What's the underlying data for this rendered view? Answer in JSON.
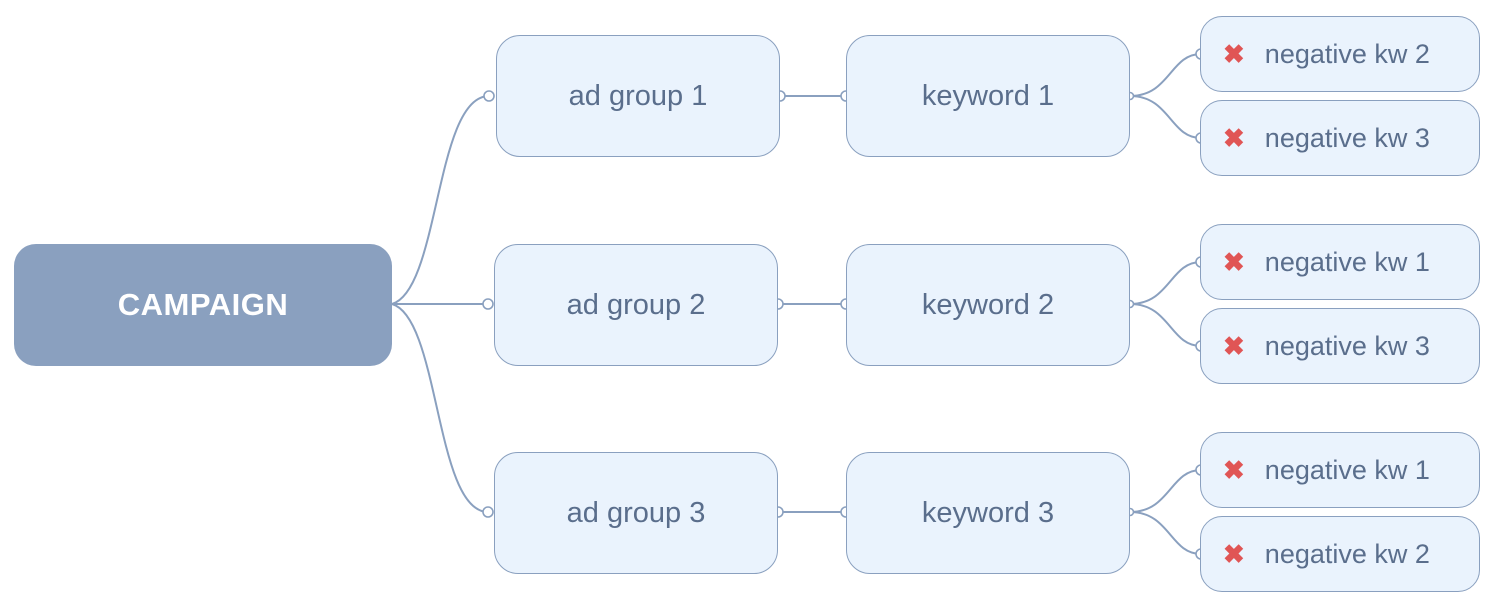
{
  "root": {
    "label": "CAMPAIGN"
  },
  "ad_groups": [
    {
      "label": "ad group 1",
      "keyword": "keyword 1",
      "negatives": [
        "negative kw 2",
        "negative kw 3"
      ]
    },
    {
      "label": "ad group 2",
      "keyword": "keyword 2",
      "negatives": [
        "negative kw 1",
        "negative kw 3"
      ]
    },
    {
      "label": "ad group 3",
      "keyword": "keyword 3",
      "negatives": [
        "negative kw 1",
        "negative kw 2"
      ]
    }
  ],
  "icons": {
    "negative": "x-icon"
  },
  "colors": {
    "root_fill": "#8aa0bf",
    "node_fill": "#eaf3fd",
    "line": "#8aa0bf",
    "negative_icon": "#e05555",
    "text": "#5a6e8c"
  }
}
